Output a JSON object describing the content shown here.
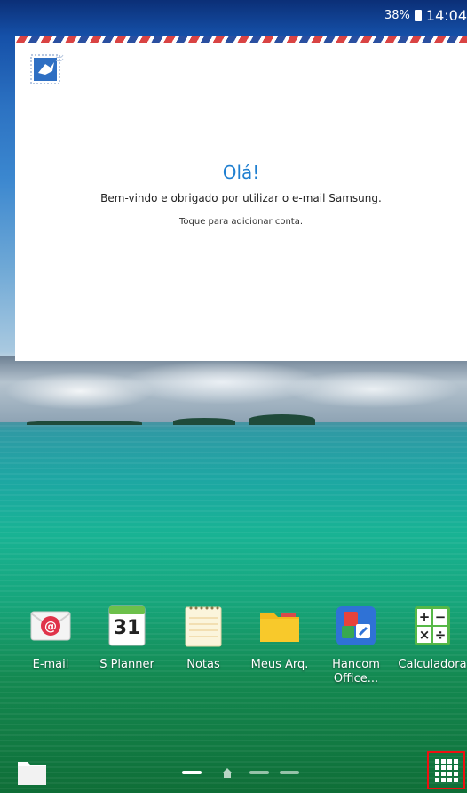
{
  "status_bar": {
    "battery": "38%",
    "time": "14:04"
  },
  "email_widget": {
    "title": "Olá!",
    "message": "Bem-vindo e obrigado por utilizar o e-mail Samsung.",
    "prompt": "Toque para adicionar conta."
  },
  "apps": [
    {
      "label": "E-mail",
      "icon": "email-icon"
    },
    {
      "label": "S Planner",
      "icon": "calendar-icon",
      "date": "31"
    },
    {
      "label": "Notas",
      "icon": "notepad-icon"
    },
    {
      "label": "Meus Arq.",
      "icon": "folder-icon"
    },
    {
      "label": "Hancom Office...",
      "icon": "hancom-office-icon"
    },
    {
      "label": "Calculadora",
      "icon": "calculator-icon",
      "keys": [
        "+",
        "−",
        "×",
        "÷"
      ]
    }
  ],
  "dock": {
    "left_icon": "folder-icon",
    "page_indicator": [
      "page",
      "home",
      "page",
      "page"
    ],
    "active_page": 0,
    "apps_button": "apps-grid-icon"
  },
  "colors": {
    "accent": "#1f7fd0",
    "highlight_border": "#ee1111"
  }
}
